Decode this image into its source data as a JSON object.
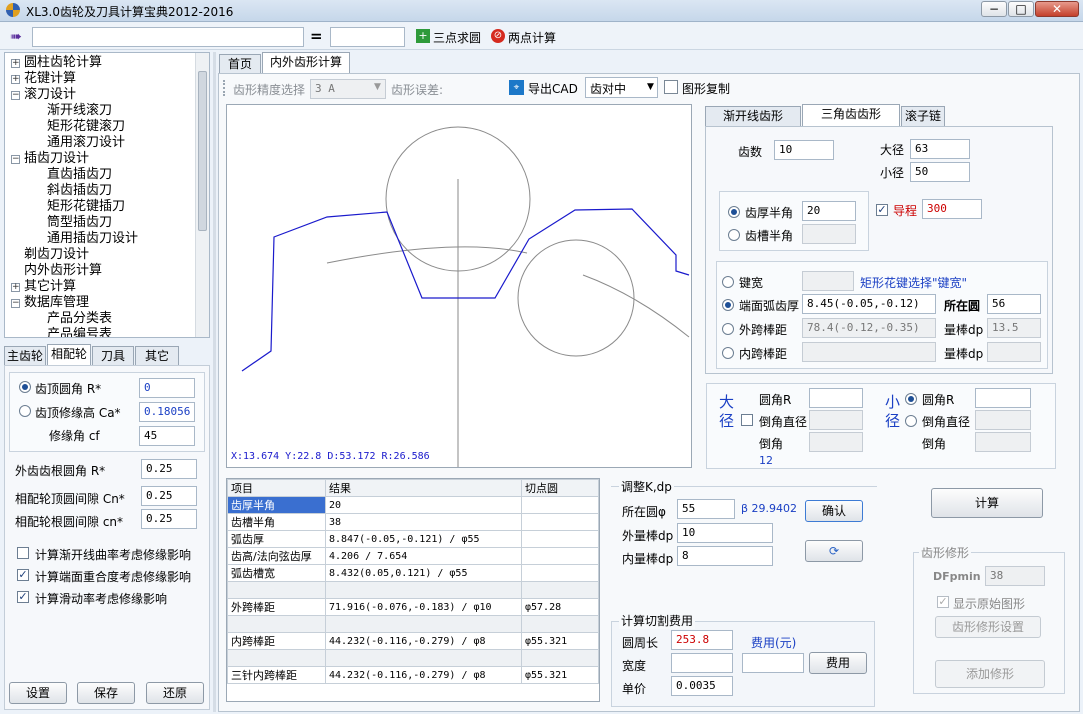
{
  "window": {
    "title": "XL3.0齿轮及刀具计算宝典2012-2016",
    "minimize": "−",
    "maximize": "□",
    "close": "✕"
  },
  "toolbar": {
    "formula_input": "",
    "equals": "=",
    "result_input": "",
    "three_point_label": "三点求圆",
    "two_point_label": "两点计算"
  },
  "tree": {
    "items": [
      {
        "label": "圆柱齿轮计算",
        "level": 0,
        "box": "+"
      },
      {
        "label": "花键计算",
        "level": 0,
        "box": "+"
      },
      {
        "label": "滚刀设计",
        "level": 0,
        "box": "−"
      },
      {
        "label": "渐开线滚刀",
        "level": 1,
        "box": ""
      },
      {
        "label": "矩形花键滚刀",
        "level": 1,
        "box": ""
      },
      {
        "label": "通用滚刀设计",
        "level": 1,
        "box": ""
      },
      {
        "label": "插齿刀设计",
        "level": 0,
        "box": "−"
      },
      {
        "label": "直齿插齿刀",
        "level": 1,
        "box": ""
      },
      {
        "label": "斜齿插齿刀",
        "level": 1,
        "box": ""
      },
      {
        "label": "矩形花键插刀",
        "level": 1,
        "box": ""
      },
      {
        "label": "筒型插齿刀",
        "level": 1,
        "box": ""
      },
      {
        "label": "通用插齿刀设计",
        "level": 1,
        "box": ""
      },
      {
        "label": "剃齿刀设计",
        "level": 0,
        "box": ""
      },
      {
        "label": "内外齿形计算",
        "level": 0,
        "box": ""
      },
      {
        "label": "其它计算",
        "level": 0,
        "box": "+"
      },
      {
        "label": "数据库管理",
        "level": 0,
        "box": "−"
      },
      {
        "label": "产品分类表",
        "level": 1,
        "box": ""
      },
      {
        "label": "产品编号表",
        "level": 1,
        "box": ""
      }
    ]
  },
  "left_tabs": [
    "主齿轮",
    "相配轮",
    "刀具",
    "其它"
  ],
  "left_panel": {
    "tip_fillet_label": "齿顶圆角 R*",
    "tip_fillet_value": "0",
    "tip_mod_label": "齿顶修缘高 Ca*",
    "tip_mod_value": "0.18056",
    "mod_angle_label": "修缘角 cf",
    "mod_angle_value": "45",
    "root_fillet_label": "外齿齿根圆角 R*",
    "root_fillet_value": "0.25",
    "mate_tip_clear_label": "相配轮顶圆间隙 Cn*",
    "mate_tip_clear_value": "0.25",
    "mate_root_clear_label": "相配轮根圆间隙 cn*",
    "mate_root_clear_value": "0.25",
    "check1": "计算渐开线曲率考虑修缘影响",
    "check2": "计算端面重合度考虑修缘影响",
    "check3": "计算滑动率考虑修缘影响",
    "btn_settings": "设置",
    "btn_save": "保存",
    "btn_restore": "还原"
  },
  "main_tabs": [
    "首页",
    "内外齿形计算"
  ],
  "subtoolbar": {
    "precision_label": "齿形精度选择",
    "precision_value": "3   A",
    "error_label": "齿形误差:",
    "export_cad": "导出CAD",
    "align_value": "齿对中",
    "copy_graph": "图形复制"
  },
  "canvas": {
    "status": "X:13.674   Y:22.8   D:53.172   R:26.586"
  },
  "right_tabs": [
    "渐开线齿形",
    "三角齿齿形",
    "滚子链"
  ],
  "tri": {
    "teeth_label": "齿数",
    "teeth_value": "10",
    "major_label": "大径",
    "major_value": "63",
    "minor_label": "小径",
    "minor_value": "50",
    "half_thick_label": "齿厚半角",
    "half_thick_value": "20",
    "half_slot_label": "齿槽半角",
    "half_slot_value": "",
    "lead_label": "导程",
    "lead_value": "300",
    "key_width_label": "键宽",
    "key_width_value": "",
    "rect_spline_note": "矩形花键选择\"键宽\"",
    "arc_thick_label": "端面弧齿厚",
    "arc_thick_value": "8.45(-0.05,-0.12)",
    "on_circle_label": "所在圆",
    "on_circle_value": "56",
    "ext_pin_label": "外跨棒距",
    "ext_pin_value": "78.4(-0.12,-0.35)",
    "ext_pin_dp_label": "量棒dp",
    "ext_pin_dp_value": "13.5",
    "int_pin_label": "内跨棒距",
    "int_pin_value": "",
    "int_pin_dp_label": "量棒dp",
    "int_pin_dp_value": ""
  },
  "chamfer": {
    "big_label": "大径",
    "small_label": "小径",
    "radius_label": "圆角R",
    "chamfer_dia_label": "倒角直径",
    "chamfer_label": "倒角",
    "big_radius_value": "",
    "big_chamfer_dia_value": "",
    "big_chamfer_value": "",
    "big_extra": "12",
    "small_radius_value": "",
    "small_chamfer_dia_value": "",
    "small_chamfer_value": ""
  },
  "results": {
    "headers": [
      "项目",
      "结果",
      "切点圆"
    ],
    "rows": [
      {
        "item": "齿厚半角",
        "result": "20",
        "tangent": "",
        "selected": true
      },
      {
        "item": "齿槽半角",
        "result": "38",
        "tangent": ""
      },
      {
        "item": "弧齿厚",
        "result": "8.847(-0.05,-0.121) / φ55",
        "tangent": ""
      },
      {
        "item": "齿高/法向弦齿厚",
        "result": "4.206 / 7.654",
        "tangent": ""
      },
      {
        "item": "弧齿槽宽",
        "result": "8.432(0.05,0.121) / φ55",
        "tangent": ""
      },
      {
        "item": "",
        "result": "",
        "tangent": ""
      },
      {
        "item": "外跨棒距",
        "result": "71.916(-0.076,-0.183) / φ10",
        "tangent": "φ57.28"
      },
      {
        "item": "",
        "result": "",
        "tangent": ""
      },
      {
        "item": "内跨棒距",
        "result": "44.232(-0.116,-0.279) / φ8",
        "tangent": "φ55.321"
      },
      {
        "item": "",
        "result": "",
        "tangent": ""
      },
      {
        "item": "三针内跨棒距",
        "result": "44.232(-0.116,-0.279) / φ8",
        "tangent": "φ55.321"
      }
    ]
  },
  "adjust": {
    "title": "调整K,dp",
    "circle_label": "所在圆φ",
    "circle_value": "55",
    "beta_text": "β 29.9402",
    "confirm": "确认",
    "ext_dp_label": "外量棒dp",
    "ext_dp_value": "10",
    "int_dp_label": "内量棒dp",
    "int_dp_value": "8"
  },
  "cost": {
    "title": "计算切割费用",
    "perimeter_label": "圆周长",
    "perimeter_value": "253.8",
    "fee_label": "费用(元)",
    "width_label": "宽度",
    "width_value": "",
    "fee_value": "",
    "fee_button": "费用",
    "price_label": "单价",
    "price_value": "0.0035"
  },
  "compute_button": "计算",
  "modify": {
    "title": "齿形修形",
    "dfpmin_label": "DFpmin",
    "dfpmin_value": "38",
    "show_original": "显示原始图形",
    "settings_button": "齿形修形设置",
    "add_button": "添加修形"
  },
  "colors": {
    "accent": "#1e4f96",
    "profile": "#1a1acc",
    "red_value": "#cc0000",
    "blue_link": "#1a3fc4",
    "selected_row": "#3a6fd0"
  }
}
